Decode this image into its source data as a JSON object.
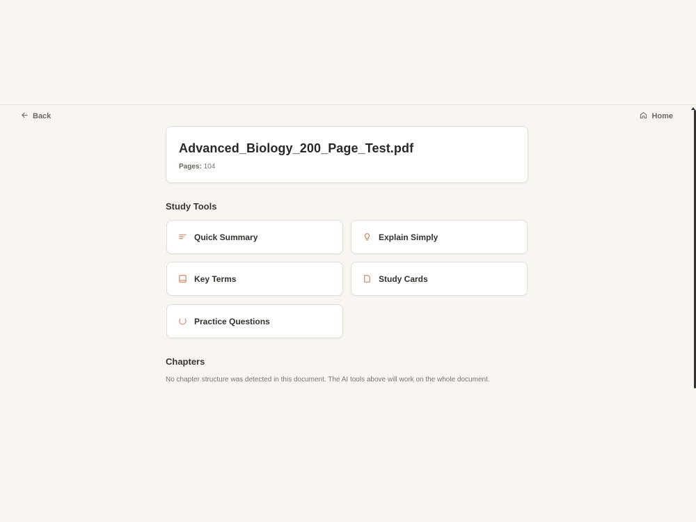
{
  "nav": {
    "back_label": "Back",
    "home_label": "Home"
  },
  "document": {
    "title": "Advanced_Biology_200_Page_Test.pdf",
    "pages_label": "Pages:",
    "pages_value": "104"
  },
  "study_tools": {
    "heading": "Study Tools",
    "items": [
      {
        "label": "Quick Summary",
        "icon": "lines-icon"
      },
      {
        "label": "Explain Simply",
        "icon": "lightbulb-icon"
      },
      {
        "label": "Key Terms",
        "icon": "book-icon"
      },
      {
        "label": "Study Cards",
        "icon": "card-icon"
      },
      {
        "label": "Practice Questions",
        "icon": "spinner-icon"
      }
    ]
  },
  "chapters": {
    "heading": "Chapters",
    "note": "No chapter structure was detected in this document. The AI tools above will work on the whole document."
  },
  "colors": {
    "background": "#f9f6f1",
    "accent": "#c9825a",
    "card": "#ffffff"
  }
}
